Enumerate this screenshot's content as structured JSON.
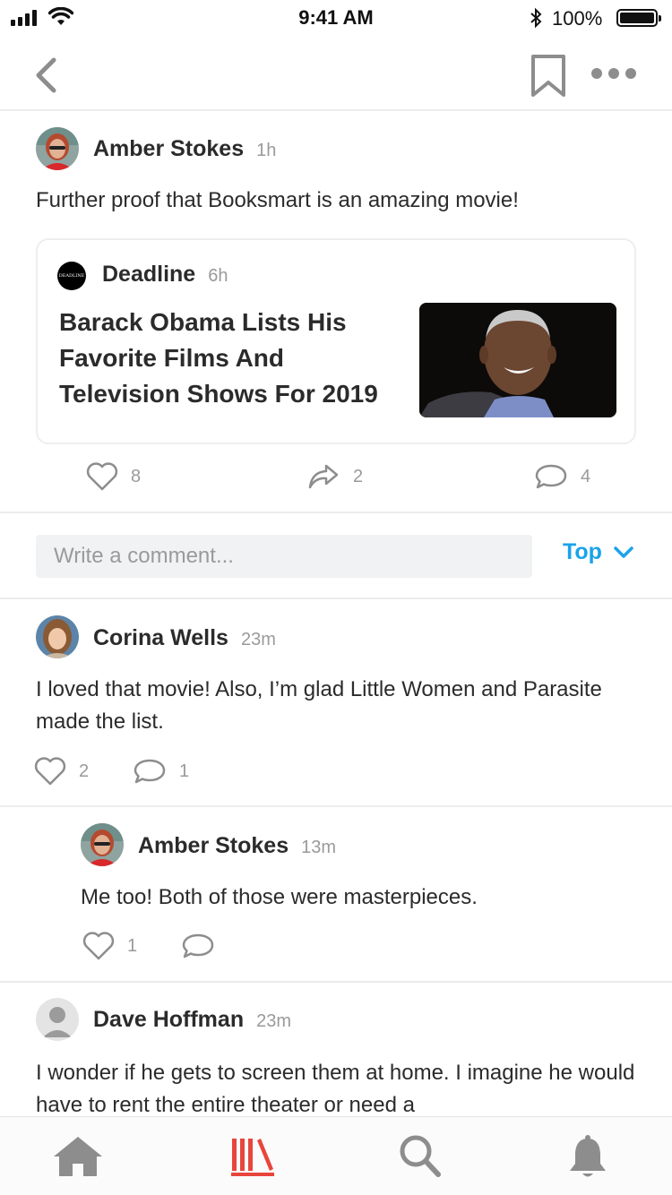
{
  "status_bar": {
    "time": "9:41 AM",
    "battery": "100%"
  },
  "post": {
    "author": "Amber Stokes",
    "time": "1h",
    "text": "Further proof that Booksmart is an amazing movie!",
    "card": {
      "source_logo_text": "DEADLINE",
      "source": "Deadline",
      "time": "6h",
      "headline": "Barack Obama Lists His Favorite Films And Television Shows For 2019"
    },
    "likes": "8",
    "shares": "2",
    "comments": "4"
  },
  "comment_input": {
    "placeholder": "Write a comment..."
  },
  "sort": {
    "label": "Top"
  },
  "comments": [
    {
      "author": "Corina Wells",
      "time": "23m",
      "text": "I loved that movie! Also, I’m glad Little Women and Parasite made the list.",
      "likes": "2",
      "replies": "1"
    },
    {
      "author": "Amber Stokes",
      "time": "13m",
      "text": "Me too! Both of those were masterpieces.",
      "likes": "1"
    },
    {
      "author": "Dave Hoffman",
      "time": "23m",
      "text": "I wonder if he gets to screen them at home. I imagine he would have to rent the entire theater or need a"
    }
  ],
  "colors": {
    "accent": "#1aa3ea",
    "active_tab": "#e8453c",
    "icon_gray": "#8d8d8d"
  },
  "tab_bar": [
    "home-icon",
    "library-icon",
    "search-icon",
    "bell-icon"
  ]
}
